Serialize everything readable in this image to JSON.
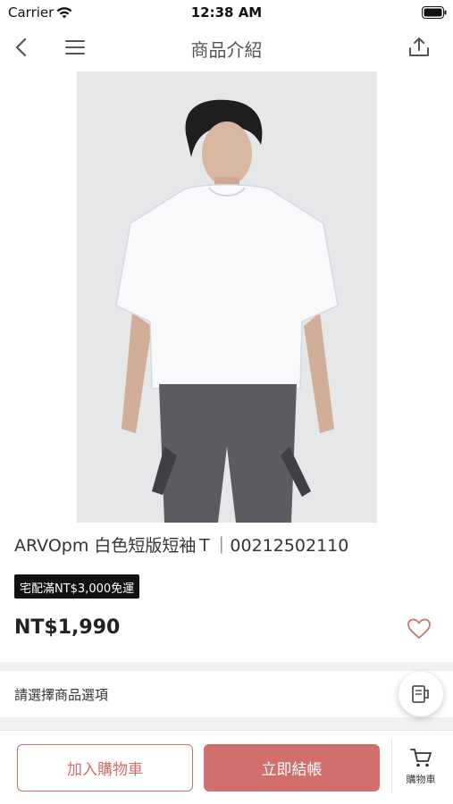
{
  "status_bar": {
    "carrier": "Carrier",
    "time": "12:38 AM"
  },
  "nav": {
    "title": "商品介紹",
    "back_icon": "chevron-left-icon",
    "menu_icon": "hamburger-menu-icon",
    "share_icon": "share-upload-icon"
  },
  "product": {
    "name": "ARVOpm 白色短版短袖Ｔ｜00212502110",
    "shipping_badge": "宅配滿NT$3,000免運",
    "price": "NT$1,990",
    "favorite_icon": "heart-outline-icon"
  },
  "options": {
    "label": "請選擇商品選項"
  },
  "bottom_bar": {
    "add_to_cart": "加入購物車",
    "checkout": "立即結帳",
    "cart_label": "購物車",
    "cart_icon": "shopping-cart-icon"
  },
  "colors": {
    "accent": "#d06f6b",
    "badge_bg": "#111111",
    "icon": "#555555"
  }
}
